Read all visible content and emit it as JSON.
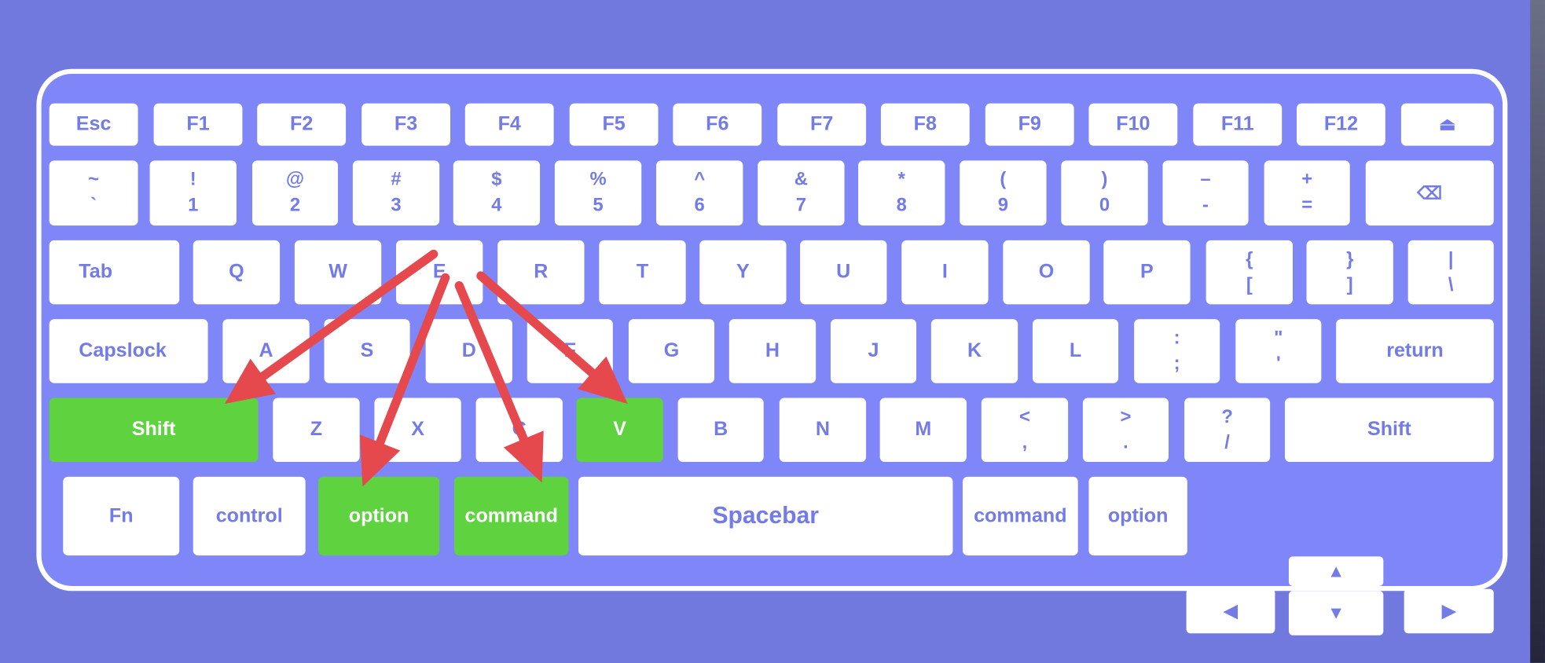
{
  "colors": {
    "background": "#7179de",
    "keyboard": "#7f86f7",
    "key": "#ffffff",
    "key_text": "#737be6",
    "highlight": "#5fd33f",
    "arrow": "#e5484d"
  },
  "rows": [
    [
      {
        "label": "Esc"
      },
      {
        "label": "F1"
      },
      {
        "label": "F2"
      },
      {
        "label": "F3"
      },
      {
        "label": "F4"
      },
      {
        "label": "F5"
      },
      {
        "label": "F6"
      },
      {
        "label": "F7"
      },
      {
        "label": "F8"
      },
      {
        "label": "F9"
      },
      {
        "label": "F10"
      },
      {
        "label": "F11"
      },
      {
        "label": "F12"
      },
      {
        "label": "⏏",
        "icon": "eject-icon"
      }
    ],
    [
      {
        "top": "~",
        "bottom": "`"
      },
      {
        "top": "!",
        "bottom": "1"
      },
      {
        "top": "@",
        "bottom": "2"
      },
      {
        "top": "#",
        "bottom": "3"
      },
      {
        "top": "$",
        "bottom": "4"
      },
      {
        "top": "%",
        "bottom": "5"
      },
      {
        "top": "^",
        "bottom": "6"
      },
      {
        "top": "&",
        "bottom": "7"
      },
      {
        "top": "*",
        "bottom": "8"
      },
      {
        "top": "(",
        "bottom": "9"
      },
      {
        "top": ")",
        "bottom": "0"
      },
      {
        "top": "–",
        "bottom": "-"
      },
      {
        "top": "+",
        "bottom": "="
      },
      {
        "label": "⌫",
        "icon": "backspace-icon"
      }
    ],
    [
      {
        "label": "Tab"
      },
      {
        "label": "Q"
      },
      {
        "label": "W"
      },
      {
        "label": "E"
      },
      {
        "label": "R"
      },
      {
        "label": "T"
      },
      {
        "label": "Y"
      },
      {
        "label": "U"
      },
      {
        "label": "I"
      },
      {
        "label": "O"
      },
      {
        "label": "P"
      },
      {
        "top": "{",
        "bottom": "["
      },
      {
        "top": "}",
        "bottom": "]"
      },
      {
        "top": "|",
        "bottom": "\\"
      }
    ],
    [
      {
        "label": "Capslock"
      },
      {
        "label": "A"
      },
      {
        "label": "S"
      },
      {
        "label": "D"
      },
      {
        "label": "F"
      },
      {
        "label": "G"
      },
      {
        "label": "H"
      },
      {
        "label": "J"
      },
      {
        "label": "K"
      },
      {
        "label": "L"
      },
      {
        "top": ":",
        "bottom": ";"
      },
      {
        "top": "\"",
        "bottom": "'"
      },
      {
        "label": "return"
      }
    ],
    [
      {
        "label": "Shift",
        "highlighted": true
      },
      {
        "label": "Z"
      },
      {
        "label": "X"
      },
      {
        "label": "C"
      },
      {
        "label": "V",
        "highlighted": true
      },
      {
        "label": "B"
      },
      {
        "label": "N"
      },
      {
        "label": "M"
      },
      {
        "top": "<",
        "bottom": ","
      },
      {
        "top": ">",
        "bottom": "."
      },
      {
        "top": "?",
        "bottom": "/"
      },
      {
        "label": "Shift"
      }
    ],
    [
      {
        "label": "Fn"
      },
      {
        "label": "control"
      },
      {
        "label": "option",
        "highlighted": true
      },
      {
        "label": "command",
        "highlighted": true
      },
      {
        "label": "Spacebar"
      },
      {
        "label": "command"
      },
      {
        "label": "option"
      }
    ],
    [
      {
        "label": "▲",
        "icon": "arrow-up-icon"
      },
      {
        "label": "◀",
        "icon": "arrow-left-icon"
      },
      {
        "label": "▼",
        "icon": "arrow-down-icon"
      },
      {
        "label": "▶",
        "icon": "arrow-right-icon"
      }
    ]
  ]
}
